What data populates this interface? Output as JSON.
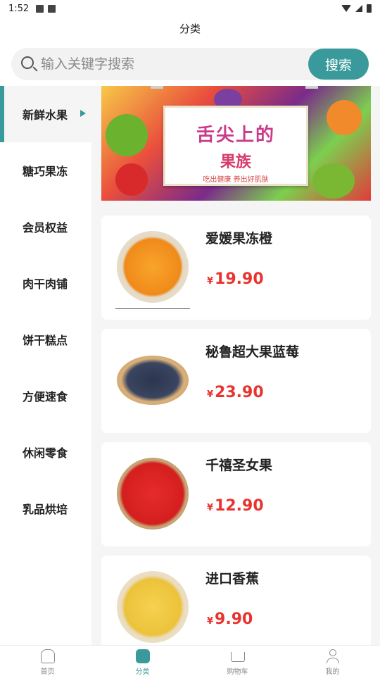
{
  "status_bar": {
    "time": "1:52"
  },
  "header": {
    "title": "分类"
  },
  "search": {
    "placeholder": "输入关键字搜索",
    "button_label": "搜索"
  },
  "sidebar": {
    "items": [
      {
        "label": "新鲜水果",
        "active": true
      },
      {
        "label": "糖巧果冻",
        "active": false
      },
      {
        "label": "会员权益",
        "active": false
      },
      {
        "label": "肉干肉铺",
        "active": false
      },
      {
        "label": "饼干糕点",
        "active": false
      },
      {
        "label": "方便速食",
        "active": false
      },
      {
        "label": "休闲零食",
        "active": false
      },
      {
        "label": "乳品烘培",
        "active": false
      }
    ]
  },
  "banner": {
    "title": "舌尖上的",
    "subtitle": "果族",
    "slogan": "吃出健康 养出好肌肤"
  },
  "products": [
    {
      "name": "爱媛果冻橙",
      "currency": "¥",
      "price": "19.90",
      "image": "orange"
    },
    {
      "name": "秘鲁超大果蓝莓",
      "currency": "¥",
      "price": "23.90",
      "image": "blueberry"
    },
    {
      "name": "千禧圣女果",
      "currency": "¥",
      "price": "12.90",
      "image": "tomato"
    },
    {
      "name": "进口香蕉",
      "currency": "¥",
      "price": "9.90",
      "image": "banana"
    }
  ],
  "tab_bar": {
    "tabs": [
      {
        "label": "首页",
        "icon": "home-icon",
        "active": false
      },
      {
        "label": "分类",
        "icon": "category-icon",
        "active": true
      },
      {
        "label": "购物车",
        "icon": "cart-icon",
        "active": false
      },
      {
        "label": "我的",
        "icon": "user-icon",
        "active": false
      }
    ]
  },
  "colors": {
    "accent": "#3a9a9b",
    "price": "#e8342f"
  }
}
